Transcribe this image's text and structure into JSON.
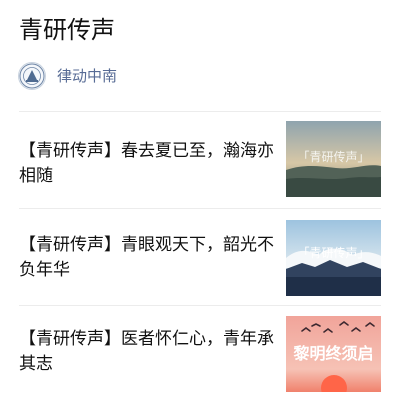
{
  "album": {
    "title": "青研传声"
  },
  "account": {
    "name": "律动中南",
    "avatar_icon": "university-emblem-icon"
  },
  "articles": [
    {
      "title": "【青研传声】春去夏已至，瀚海亦相随",
      "thumb_text": "「青研传声」",
      "thumb_theme": "sunset-lake"
    },
    {
      "title": "【青研传声】青眼观天下，韶光不负年华",
      "thumb_text": "「青研传声」",
      "thumb_theme": "mountain-cloud"
    },
    {
      "title": "【青研传声】医者怀仁心，青年承其志",
      "thumb_text": "黎明终须启",
      "thumb_theme": "dawn-birds"
    }
  ],
  "colors": {
    "account_name": "#576b95",
    "divider": "#ececec",
    "title_text": "#111111"
  }
}
